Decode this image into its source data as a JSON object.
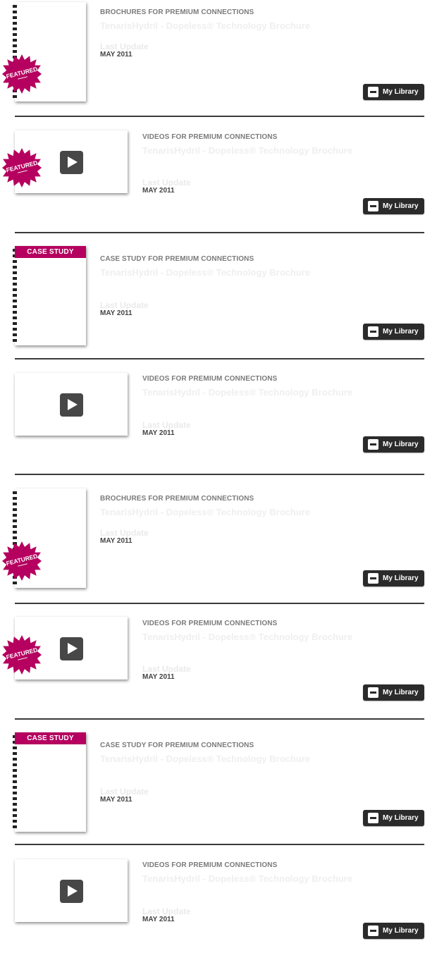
{
  "common": {
    "title": "TenarisHydril - Dopeless® Technology Brochure",
    "last_update_label": "Last Update",
    "date": "MAY 2011",
    "button_label": "My Library",
    "featured_label": "FEATURED",
    "case_study_label": "CASE STUDY",
    "accent_color": "#b5005f"
  },
  "items": [
    {
      "kind": "brochure",
      "featured": true,
      "case_study": false,
      "category": "BROCHURES FOR PREMIUM CONNECTIONS"
    },
    {
      "kind": "video",
      "featured": true,
      "case_study": false,
      "category": "VIDEOS FOR PREMIUM CONNECTIONS"
    },
    {
      "kind": "brochure",
      "featured": false,
      "case_study": true,
      "category": "CASE STUDY FOR PREMIUM CONNECTIONS"
    },
    {
      "kind": "video",
      "featured": false,
      "case_study": false,
      "category": "VIDEOS FOR PREMIUM CONNECTIONS"
    },
    {
      "kind": "brochure",
      "featured": true,
      "case_study": false,
      "category": "BROCHURES FOR PREMIUM CONNECTIONS"
    },
    {
      "kind": "video",
      "featured": true,
      "case_study": false,
      "category": "VIDEOS FOR PREMIUM CONNECTIONS"
    },
    {
      "kind": "brochure",
      "featured": false,
      "case_study": true,
      "category": "CASE STUDY FOR PREMIUM CONNECTIONS"
    },
    {
      "kind": "video",
      "featured": false,
      "case_study": false,
      "category": "VIDEOS FOR PREMIUM CONNECTIONS"
    }
  ]
}
